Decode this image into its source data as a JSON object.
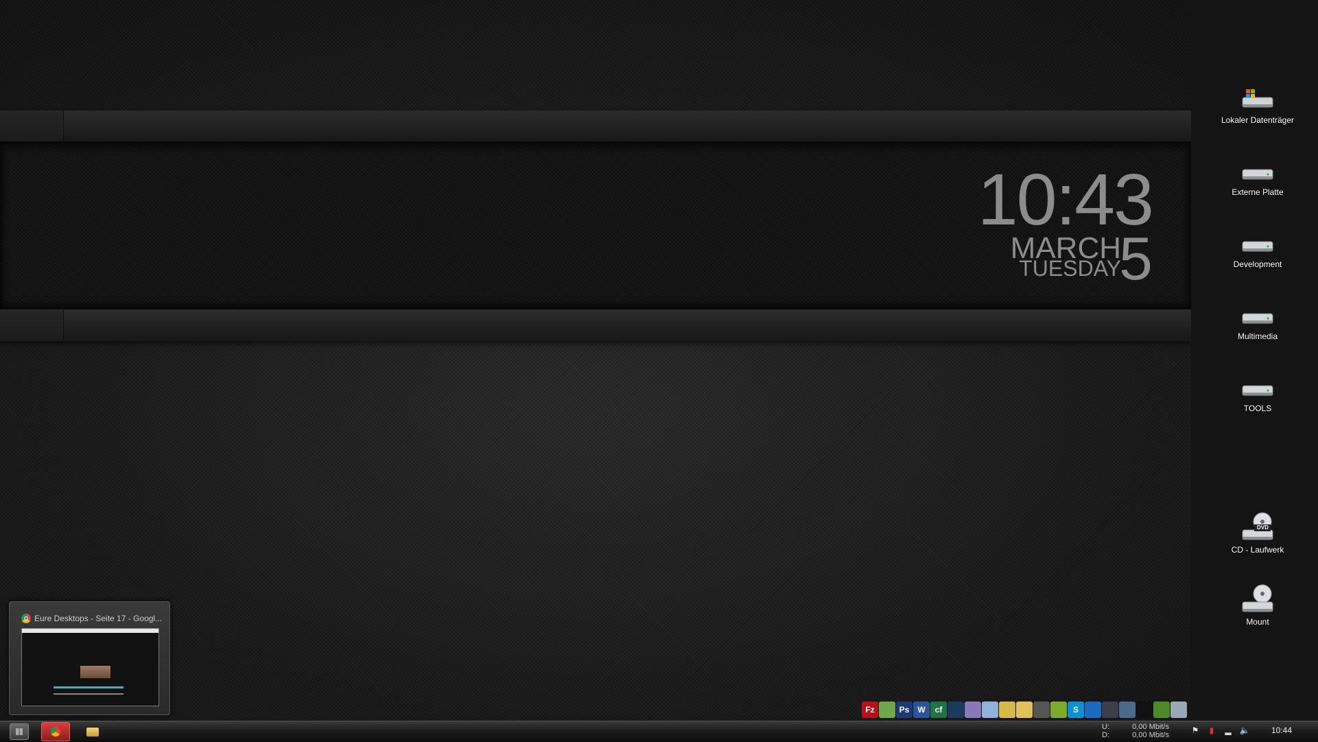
{
  "clock": {
    "time": "10:43",
    "month": "MARCH",
    "day": "5",
    "weekday": "TUESDAY"
  },
  "desktop_icons": [
    {
      "label": "Lokaler Datenträger",
      "icon": "windows-drive-icon"
    },
    {
      "label": "Externe Platte",
      "icon": "drive-icon"
    },
    {
      "label": "Development",
      "icon": "drive-icon"
    },
    {
      "label": "Multimedia",
      "icon": "drive-icon"
    },
    {
      "label": "TOOLS",
      "icon": "drive-icon"
    },
    {
      "label": "CD - Laufwerk",
      "icon": "dvd-drive-icon",
      "badge": "DVD"
    },
    {
      "label": "Mount",
      "icon": "disc-drive-icon"
    }
  ],
  "preview": {
    "title": "Eure Desktops - Seite 17 - Googl..."
  },
  "quick_launch": [
    {
      "name": "filezilla-icon",
      "text": "Fz",
      "color": "#b5121b"
    },
    {
      "name": "notepadpp-icon",
      "text": "",
      "color": "#6fa84a"
    },
    {
      "name": "photoshop-icon",
      "text": "Ps",
      "color": "#1f3a72"
    },
    {
      "name": "word-icon",
      "text": "W",
      "color": "#2a5699"
    },
    {
      "name": "excel-icon",
      "text": "cf",
      "color": "#217346"
    },
    {
      "name": "eclipse-icon",
      "text": "",
      "color": "#1c3a5e"
    },
    {
      "name": "orb-icon",
      "text": "",
      "color": "#8878b8"
    },
    {
      "name": "box-icon",
      "text": "",
      "color": "#8fb3d9"
    },
    {
      "name": "download-icon",
      "text": "",
      "color": "#d8b84a"
    },
    {
      "name": "folder-icon",
      "text": "",
      "color": "#e3c15a"
    },
    {
      "name": "media-player-icon",
      "text": "",
      "color": "#555"
    },
    {
      "name": "recycle-app-icon",
      "text": "",
      "color": "#7caa2a"
    },
    {
      "name": "skype-icon",
      "text": "S",
      "color": "#0a8fd8"
    },
    {
      "name": "teamviewer-icon",
      "text": "",
      "color": "#1b6cc0"
    },
    {
      "name": "steam-icon",
      "text": "",
      "color": "#3a3f4a"
    },
    {
      "name": "network-icon",
      "text": "",
      "color": "#4c6a8c"
    },
    {
      "name": "console-icon",
      "text": "",
      "color": "#111"
    },
    {
      "name": "minecraft-icon",
      "text": "",
      "color": "#4c8a2a"
    },
    {
      "name": "recycle-bin-icon",
      "text": "",
      "color": "#9aa8b5"
    }
  ],
  "network": {
    "up_label": "U:",
    "up_value": "0,00 Mbit/s",
    "down_label": "D:",
    "down_value": "0,00 Mbit/s"
  },
  "taskbar_clock": "10:44"
}
